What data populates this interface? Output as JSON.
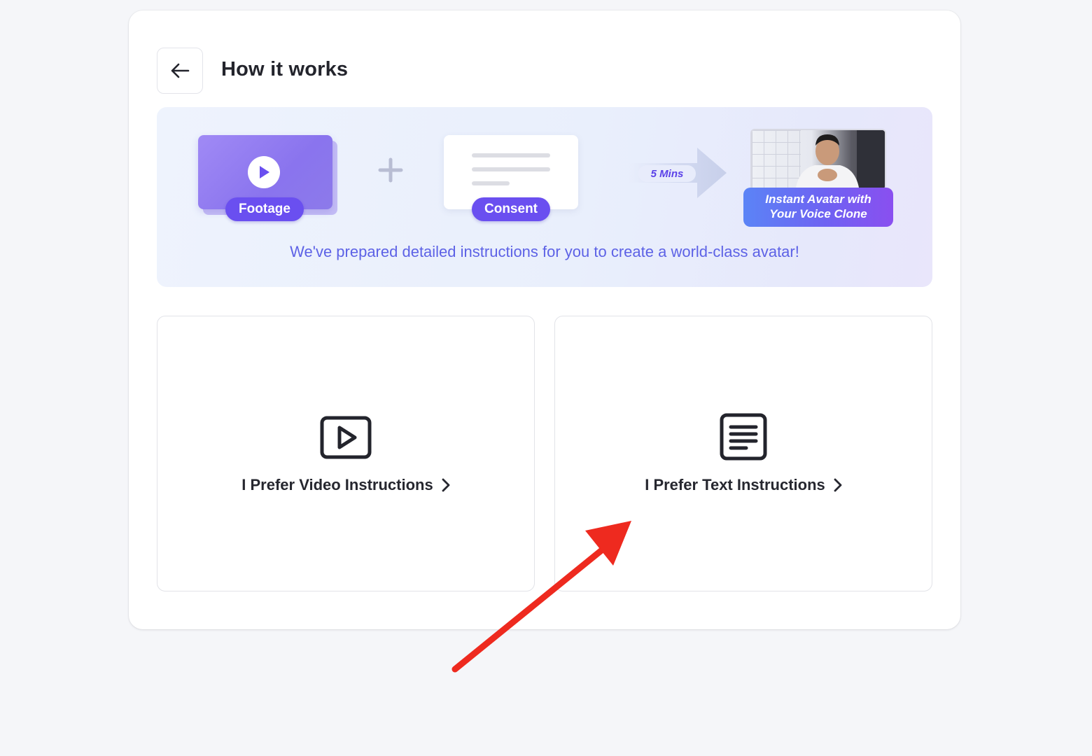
{
  "header": {
    "title": "How it works"
  },
  "banner": {
    "footage_label": "Footage",
    "consent_label": "Consent",
    "duration_label": "5 Mins",
    "result_label_line1": "Instant Avatar with",
    "result_label_line2": "Your Voice Clone",
    "caption": "We've prepared detailed instructions for you to create a world-class avatar!"
  },
  "options": [
    {
      "label": "I Prefer Video Instructions",
      "icon": "video-play-icon"
    },
    {
      "label": "I Prefer Text Instructions",
      "icon": "text-document-icon"
    }
  ],
  "colors": {
    "accent": "#6a4ff0",
    "caption": "#5d62e6",
    "annotation_arrow": "#ee2a1f"
  }
}
